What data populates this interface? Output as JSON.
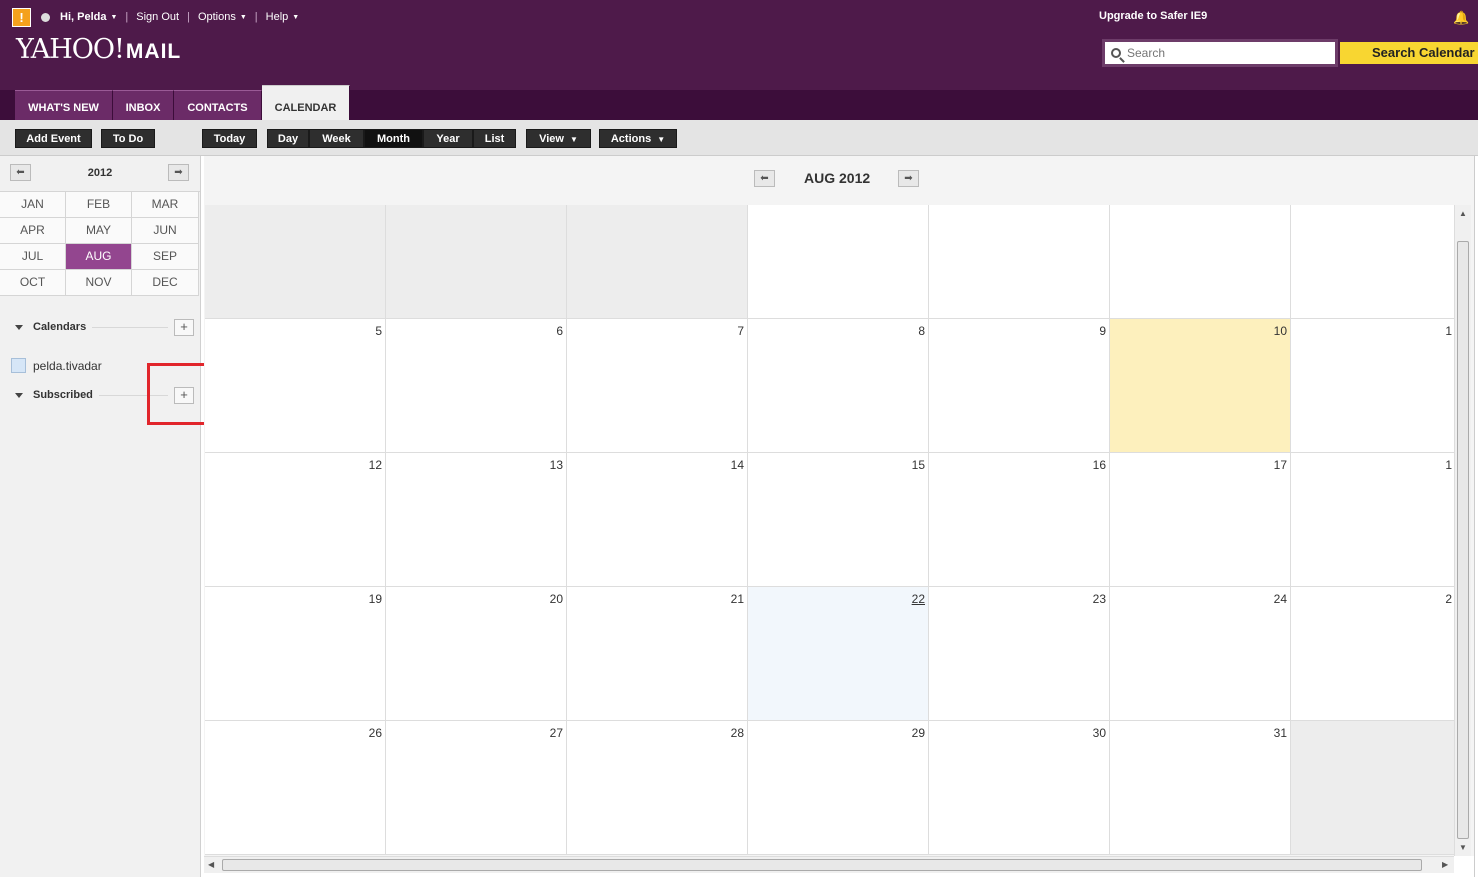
{
  "header": {
    "greeting": "Hi, Pelda",
    "sign_out": "Sign Out",
    "options": "Options",
    "help": "Help",
    "upgrade": "Upgrade to Safer IE9",
    "logo_text": "YAHOO!",
    "logo_mail": "MAIL",
    "search_placeholder": "Search",
    "search_button": "Search Calendar"
  },
  "tabs": [
    {
      "label": "WHAT'S NEW"
    },
    {
      "label": "INBOX"
    },
    {
      "label": "CONTACTS"
    },
    {
      "label": "CALENDAR",
      "active": true
    }
  ],
  "toolbar": {
    "add_event": "Add Event",
    "todo": "To Do",
    "today": "Today",
    "day": "Day",
    "week": "Week",
    "month": "Month",
    "year": "Year",
    "list": "List",
    "view": "View",
    "actions": "Actions"
  },
  "sidebar": {
    "year": "2012",
    "months": [
      "JAN",
      "FEB",
      "MAR",
      "APR",
      "MAY",
      "JUN",
      "JUL",
      "AUG",
      "SEP",
      "OCT",
      "NOV",
      "DEC"
    ],
    "selected_month": "AUG",
    "calendars_label": "Calendars",
    "calendar_name": "pelda.tivadar",
    "subscribed_label": "Subscribed"
  },
  "main": {
    "month_label": "AUG 2012",
    "weeks": [
      [
        "",
        "",
        "",
        "",
        "",
        "",
        ""
      ],
      [
        "5",
        "6",
        "7",
        "8",
        "9",
        "10",
        "1"
      ],
      [
        "12",
        "13",
        "14",
        "15",
        "16",
        "17",
        "1"
      ],
      [
        "19",
        "20",
        "21",
        "22",
        "23",
        "24",
        "2"
      ],
      [
        "26",
        "27",
        "28",
        "29",
        "30",
        "31",
        ""
      ]
    ]
  },
  "colors": {
    "header_bg": "#4e1a4a",
    "accent": "#93468f",
    "search_button": "#f8d631",
    "today": "#fdf0bd"
  }
}
